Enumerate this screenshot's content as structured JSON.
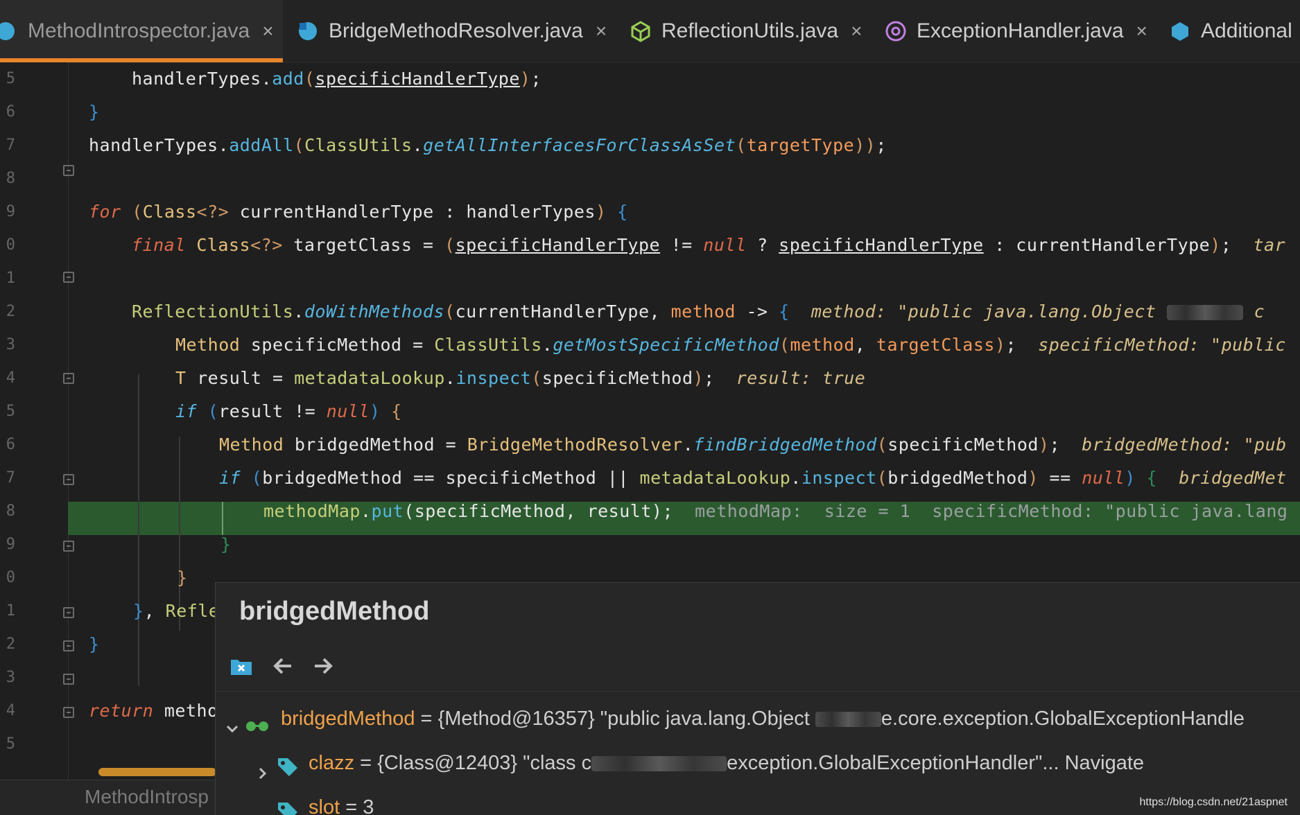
{
  "tabs": [
    {
      "label": "MethodIntrospector.java",
      "icon": "java-class-icon",
      "active": true
    },
    {
      "label": "BridgeMethodResolver.java",
      "icon": "java-class-icon",
      "active": false
    },
    {
      "label": "ReflectionUtils.java",
      "icon": "java-abstract-class-icon",
      "active": false
    },
    {
      "label": "ExceptionHandler.java",
      "icon": "annotation-icon",
      "active": false
    },
    {
      "label": "Additional",
      "icon": "java-interface-icon",
      "active": false
    }
  ],
  "close_glyph": "×",
  "line_numbers": [
    "5",
    "6",
    "7",
    "8",
    "9",
    "0",
    "1",
    "2",
    "3",
    "4",
    "5",
    "6",
    "7",
    "8",
    "9",
    "0",
    "1",
    "2",
    "3",
    "4",
    "5"
  ],
  "code": {
    "l1": {
      "a": "handlerTypes",
      "b": ".",
      "c": "add",
      "d": "(",
      "e": "specificHandlerType",
      "f": ")",
      "g": ";"
    },
    "l2": {
      "a": "}"
    },
    "l3": {
      "a": "handlerTypes",
      "b": ".",
      "c": "addAll",
      "d": "(",
      "e": "ClassUtils",
      "f": ".",
      "g": "getAllInterfacesForClassAsSet",
      "h": "(",
      "i": "targetType",
      "j": "))",
      "k": ";"
    },
    "l5": {
      "a": "for",
      "b": "(",
      "c": "Class",
      "d": "<?>",
      "e": " currentHandlerType : handlerTypes",
      "f": ")",
      "g": "{"
    },
    "l6": {
      "a": "final",
      "b": "Class",
      "c": "<?>",
      "d": " targetClass = ",
      "e": "(",
      "f": "specificHandlerType",
      "g": " != ",
      "h": "null",
      "i": " ? ",
      "j": "specificHandlerType",
      "k": " : currentHandlerType",
      "l": ")",
      "m": ";",
      "n": "tar"
    },
    "l8": {
      "a": "ReflectionUtils",
      "b": ".",
      "c": "doWithMethods",
      "d": "(",
      "e": "currentHandlerType, ",
      "f": "method",
      "g": " -> ",
      "h": "{",
      "i": "method: \"public java.lang.Object ",
      "j": "c"
    },
    "l9": {
      "a": "Method",
      "b": " specificMethod = ",
      "c": "ClassUtils",
      "d": ".",
      "e": "getMostSpecificMethod",
      "f": "(",
      "g": "method",
      "h": ", ",
      "i": "targetClass",
      "j": ")",
      "k": ";",
      "l": "specificMethod: \"public"
    },
    "l10": {
      "a": "T",
      "b": " result = ",
      "c": "metadataLookup",
      "d": ".",
      "e": "inspect",
      "f": "(",
      "g": "specificMethod",
      "h": ")",
      "i": ";",
      "j": "result: true"
    },
    "l11": {
      "a": "if",
      "b": "(",
      "c": "result != ",
      "d": "null",
      "e": ")",
      "f": "{"
    },
    "l12": {
      "a": "Method",
      "b": " bridgedMethod = ",
      "c": "BridgeMethodResolver",
      "d": ".",
      "e": "findBridgedMethod",
      "f": "(",
      "g": "specificMethod",
      "h": ")",
      "i": ";",
      "j": "bridgedMethod: \"pub"
    },
    "l13": {
      "a": "if",
      "b": "(",
      "c": "bridgedMethod == specificMethod || ",
      "d": "metadataLookup",
      "e": ".",
      "f": "inspect",
      "g": "(",
      "h": "bridgedMethod",
      "i": ")",
      "j": " == ",
      "k": "null",
      "l": ")",
      "m": "{",
      "n": "bridgedMet"
    },
    "l14": {
      "a": "methodMap",
      "b": ".",
      "c": "put",
      "d": "(",
      "e": "specificMethod, result",
      "f": ")",
      "g": ";",
      "h": "methodMap:  size = 1  specificMethod: \"public java.lang"
    },
    "l15": {
      "a": "}"
    },
    "l16": {
      "a": "}"
    },
    "l17": {
      "a": "}",
      "b": ", ",
      "c": "Refle"
    },
    "l18": {
      "a": "}"
    },
    "l20": {
      "a": "return",
      "b": " metho"
    }
  },
  "status_file": "MethodIntrosp",
  "popup": {
    "title": "bridgedMethod",
    "tools": [
      "folder-close-icon",
      "back-arrow-icon",
      "forward-arrow-icon"
    ],
    "rows": [
      {
        "name": "bridgedMethod",
        "eq": " = ",
        "value_a": "{Method@16357} \"public java.lang.Object ",
        "value_b": "e.core.exception.GlobalExceptionHandle",
        "icon": "watch-glasses-icon",
        "expanded": true
      },
      {
        "name": "clazz",
        "eq": " = ",
        "value_a": "{Class@12403} \"class c",
        "value_b": "exception.GlobalExceptionHandler\"... ",
        "nav": "Navigate",
        "icon": "field-tag-icon",
        "expanded": false
      },
      {
        "name": "slot",
        "eq": " = ",
        "value_a": "3",
        "icon": "field-tag-icon"
      }
    ]
  },
  "watermark": "https://blog.csdn.net/21aspnet",
  "colors": {
    "accent_tab": "#e8842a",
    "highlight_line": "#2b5a2f",
    "background": "#1f1f1f"
  }
}
